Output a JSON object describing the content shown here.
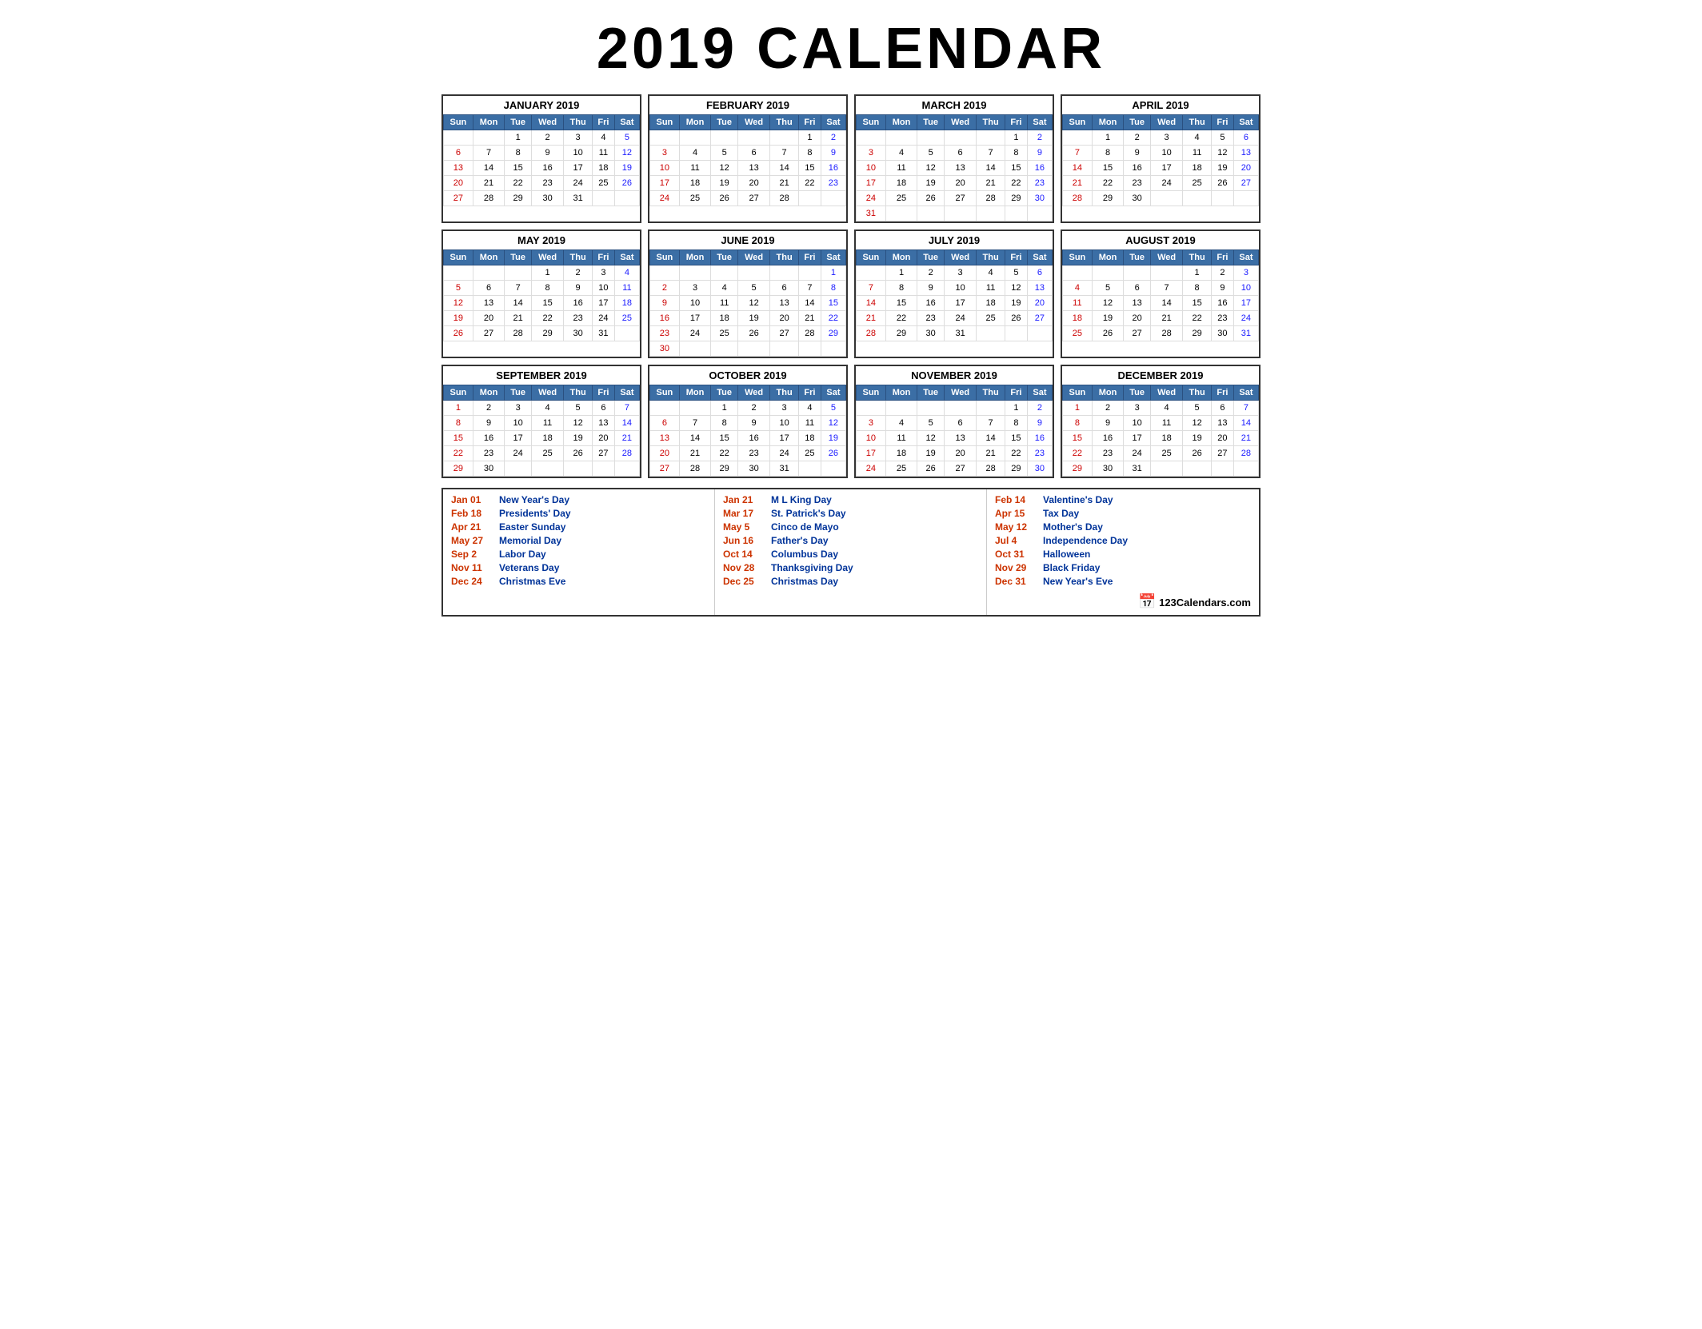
{
  "title": "2019 CALENDAR",
  "months": [
    {
      "name": "JANUARY 2019",
      "days": [
        [
          "",
          "",
          "1",
          "2",
          "3",
          "4",
          "5"
        ],
        [
          "6",
          "7",
          "8",
          "9",
          "10",
          "11",
          "12"
        ],
        [
          "13",
          "14",
          "15",
          "16",
          "17",
          "18",
          "19"
        ],
        [
          "20",
          "21",
          "22",
          "23",
          "24",
          "25",
          "26"
        ],
        [
          "27",
          "28",
          "29",
          "30",
          "31",
          "",
          ""
        ]
      ]
    },
    {
      "name": "FEBRUARY 2019",
      "days": [
        [
          "",
          "",
          "",
          "",
          "",
          "1",
          "2"
        ],
        [
          "3",
          "4",
          "5",
          "6",
          "7",
          "8",
          "9"
        ],
        [
          "10",
          "11",
          "12",
          "13",
          "14",
          "15",
          "16"
        ],
        [
          "17",
          "18",
          "19",
          "20",
          "21",
          "22",
          "23"
        ],
        [
          "24",
          "25",
          "26",
          "27",
          "28",
          "",
          ""
        ]
      ]
    },
    {
      "name": "MARCH 2019",
      "days": [
        [
          "",
          "",
          "",
          "",
          "",
          "1",
          "2"
        ],
        [
          "3",
          "4",
          "5",
          "6",
          "7",
          "8",
          "9"
        ],
        [
          "10",
          "11",
          "12",
          "13",
          "14",
          "15",
          "16"
        ],
        [
          "17",
          "18",
          "19",
          "20",
          "21",
          "22",
          "23"
        ],
        [
          "24",
          "25",
          "26",
          "27",
          "28",
          "29",
          "30"
        ],
        [
          "31",
          "",
          "",
          "",
          "",
          "",
          ""
        ]
      ]
    },
    {
      "name": "APRIL 2019",
      "days": [
        [
          "",
          "1",
          "2",
          "3",
          "4",
          "5",
          "6"
        ],
        [
          "7",
          "8",
          "9",
          "10",
          "11",
          "12",
          "13"
        ],
        [
          "14",
          "15",
          "16",
          "17",
          "18",
          "19",
          "20"
        ],
        [
          "21",
          "22",
          "23",
          "24",
          "25",
          "26",
          "27"
        ],
        [
          "28",
          "29",
          "30",
          "",
          "",
          "",
          ""
        ]
      ]
    },
    {
      "name": "MAY 2019",
      "days": [
        [
          "",
          "",
          "",
          "1",
          "2",
          "3",
          "4"
        ],
        [
          "5",
          "6",
          "7",
          "8",
          "9",
          "10",
          "11"
        ],
        [
          "12",
          "13",
          "14",
          "15",
          "16",
          "17",
          "18"
        ],
        [
          "19",
          "20",
          "21",
          "22",
          "23",
          "24",
          "25"
        ],
        [
          "26",
          "27",
          "28",
          "29",
          "30",
          "31",
          ""
        ]
      ]
    },
    {
      "name": "JUNE 2019",
      "days": [
        [
          "",
          "",
          "",
          "",
          "",
          "",
          "1"
        ],
        [
          "2",
          "3",
          "4",
          "5",
          "6",
          "7",
          "8"
        ],
        [
          "9",
          "10",
          "11",
          "12",
          "13",
          "14",
          "15"
        ],
        [
          "16",
          "17",
          "18",
          "19",
          "20",
          "21",
          "22"
        ],
        [
          "23",
          "24",
          "25",
          "26",
          "27",
          "28",
          "29"
        ],
        [
          "30",
          "",
          "",
          "",
          "",
          "",
          ""
        ]
      ]
    },
    {
      "name": "JULY 2019",
      "days": [
        [
          "",
          "1",
          "2",
          "3",
          "4",
          "5",
          "6"
        ],
        [
          "7",
          "8",
          "9",
          "10",
          "11",
          "12",
          "13"
        ],
        [
          "14",
          "15",
          "16",
          "17",
          "18",
          "19",
          "20"
        ],
        [
          "21",
          "22",
          "23",
          "24",
          "25",
          "26",
          "27"
        ],
        [
          "28",
          "29",
          "30",
          "31",
          "",
          "",
          ""
        ]
      ]
    },
    {
      "name": "AUGUST 2019",
      "days": [
        [
          "",
          "",
          "",
          "",
          "1",
          "2",
          "3"
        ],
        [
          "4",
          "5",
          "6",
          "7",
          "8",
          "9",
          "10"
        ],
        [
          "11",
          "12",
          "13",
          "14",
          "15",
          "16",
          "17"
        ],
        [
          "18",
          "19",
          "20",
          "21",
          "22",
          "23",
          "24"
        ],
        [
          "25",
          "26",
          "27",
          "28",
          "29",
          "30",
          "31"
        ]
      ]
    },
    {
      "name": "SEPTEMBER 2019",
      "days": [
        [
          "1",
          "2",
          "3",
          "4",
          "5",
          "6",
          "7"
        ],
        [
          "8",
          "9",
          "10",
          "11",
          "12",
          "13",
          "14"
        ],
        [
          "15",
          "16",
          "17",
          "18",
          "19",
          "20",
          "21"
        ],
        [
          "22",
          "23",
          "24",
          "25",
          "26",
          "27",
          "28"
        ],
        [
          "29",
          "30",
          "",
          "",
          "",
          "",
          ""
        ]
      ]
    },
    {
      "name": "OCTOBER 2019",
      "days": [
        [
          "",
          "",
          "1",
          "2",
          "3",
          "4",
          "5"
        ],
        [
          "6",
          "7",
          "8",
          "9",
          "10",
          "11",
          "12"
        ],
        [
          "13",
          "14",
          "15",
          "16",
          "17",
          "18",
          "19"
        ],
        [
          "20",
          "21",
          "22",
          "23",
          "24",
          "25",
          "26"
        ],
        [
          "27",
          "28",
          "29",
          "30",
          "31",
          "",
          ""
        ]
      ]
    },
    {
      "name": "NOVEMBER 2019",
      "days": [
        [
          "",
          "",
          "",
          "",
          "",
          "1",
          "2"
        ],
        [
          "3",
          "4",
          "5",
          "6",
          "7",
          "8",
          "9"
        ],
        [
          "10",
          "11",
          "12",
          "13",
          "14",
          "15",
          "16"
        ],
        [
          "17",
          "18",
          "19",
          "20",
          "21",
          "22",
          "23"
        ],
        [
          "24",
          "25",
          "26",
          "27",
          "28",
          "29",
          "30"
        ]
      ]
    },
    {
      "name": "DECEMBER 2019",
      "days": [
        [
          "1",
          "2",
          "3",
          "4",
          "5",
          "6",
          "7"
        ],
        [
          "8",
          "9",
          "10",
          "11",
          "12",
          "13",
          "14"
        ],
        [
          "15",
          "16",
          "17",
          "18",
          "19",
          "20",
          "21"
        ],
        [
          "22",
          "23",
          "24",
          "25",
          "26",
          "27",
          "28"
        ],
        [
          "29",
          "30",
          "31",
          "",
          "",
          "",
          ""
        ]
      ]
    }
  ],
  "weekdays": [
    "Sun",
    "Mon",
    "Tue",
    "Wed",
    "Thu",
    "Fri",
    "Sat"
  ],
  "holidays_col1": [
    {
      "date": "Jan 01",
      "name": "New Year's Day"
    },
    {
      "date": "Feb 18",
      "name": "Presidents' Day"
    },
    {
      "date": "Apr 21",
      "name": "Easter Sunday"
    },
    {
      "date": "May 27",
      "name": "Memorial Day"
    },
    {
      "date": "Sep 2",
      "name": "Labor Day"
    },
    {
      "date": "Nov 11",
      "name": "Veterans Day"
    },
    {
      "date": "Dec 24",
      "name": "Christmas Eve"
    }
  ],
  "holidays_col2": [
    {
      "date": "Jan 21",
      "name": "M L King Day"
    },
    {
      "date": "Mar 17",
      "name": "St. Patrick's Day"
    },
    {
      "date": "May 5",
      "name": "Cinco de Mayo"
    },
    {
      "date": "Jun 16",
      "name": "Father's Day"
    },
    {
      "date": "Oct 14",
      "name": "Columbus Day"
    },
    {
      "date": "Nov 28",
      "name": "Thanksgiving Day"
    },
    {
      "date": "Dec 25",
      "name": "Christmas Day"
    }
  ],
  "holidays_col3": [
    {
      "date": "Feb 14",
      "name": "Valentine's Day"
    },
    {
      "date": "Apr 15",
      "name": "Tax Day"
    },
    {
      "date": "May 12",
      "name": "Mother's Day"
    },
    {
      "date": "Jul 4",
      "name": "Independence Day"
    },
    {
      "date": "Oct 31",
      "name": "Halloween"
    },
    {
      "date": "Nov 29",
      "name": "Black Friday"
    },
    {
      "date": "Dec 31",
      "name": "New Year's Eve"
    }
  ],
  "logo": "123Calendars.com"
}
